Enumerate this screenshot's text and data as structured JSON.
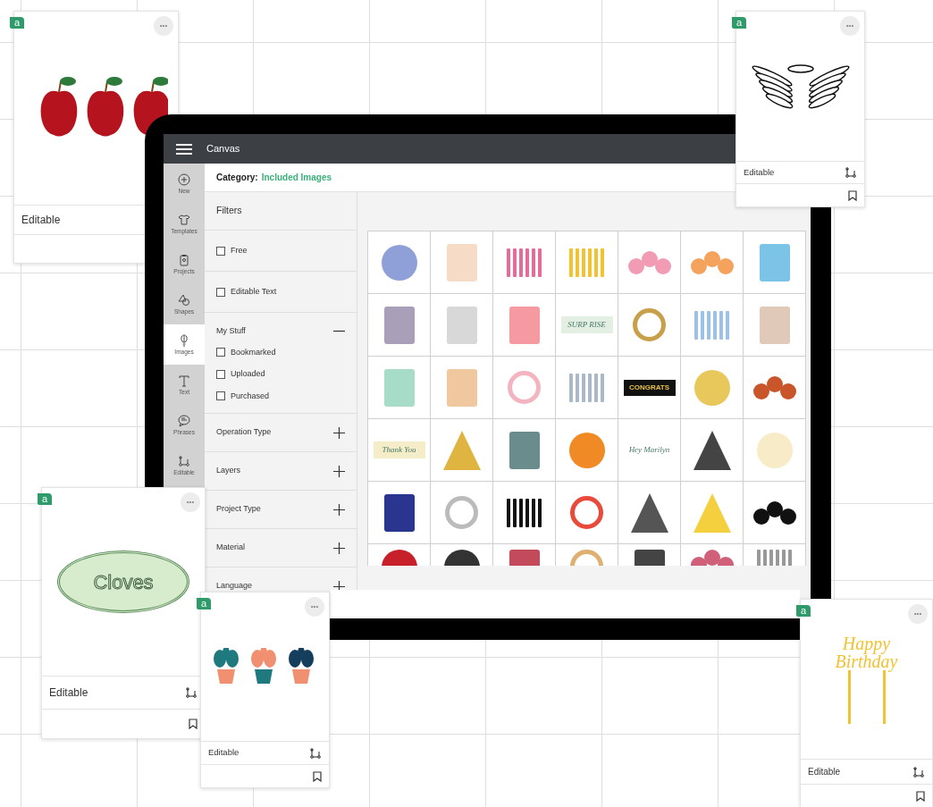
{
  "app": {
    "title": "Canvas",
    "category_label": "Category:",
    "category_value": "Included Images"
  },
  "sidebar": {
    "items": [
      {
        "label": "New",
        "selected": false
      },
      {
        "label": "Templates",
        "selected": false
      },
      {
        "label": "Projects",
        "selected": false
      },
      {
        "label": "Shapes",
        "selected": false
      },
      {
        "label": "Images",
        "selected": true
      },
      {
        "label": "Text",
        "selected": false
      },
      {
        "label": "Phrases",
        "selected": false
      },
      {
        "label": "Editable",
        "selected": false
      }
    ]
  },
  "filters": {
    "title": "Filters",
    "sections": [
      {
        "kind": "checkbox",
        "label": "Free",
        "checked": false
      },
      {
        "kind": "checkbox",
        "label": "Editable Text",
        "checked": false
      },
      {
        "kind": "group",
        "label": "My Stuff",
        "expanded": true,
        "items": [
          {
            "label": "Bookmarked",
            "checked": false
          },
          {
            "label": "Uploaded",
            "checked": false
          },
          {
            "label": "Purchased",
            "checked": false
          }
        ]
      },
      {
        "kind": "group",
        "label": "Operation Type",
        "expanded": false
      },
      {
        "kind": "group",
        "label": "Layers",
        "expanded": false
      },
      {
        "kind": "group",
        "label": "Project Type",
        "expanded": false
      },
      {
        "kind": "group",
        "label": "Material",
        "expanded": false
      },
      {
        "kind": "group",
        "label": "Language",
        "expanded": false
      }
    ]
  },
  "tiles": [
    {
      "kind": "circle",
      "color": "#8fa0d8"
    },
    {
      "kind": "rect",
      "color": "#f6dcc6"
    },
    {
      "kind": "bars",
      "color": "#e86a9a"
    },
    {
      "kind": "bars",
      "color": "#f2c230"
    },
    {
      "kind": "circles3",
      "color": "#f29bb5"
    },
    {
      "kind": "circles3",
      "color": "#f5a25d"
    },
    {
      "kind": "rect",
      "color": "#7cc3e8"
    },
    {
      "kind": "rect",
      "color": "#a99fb8"
    },
    {
      "kind": "rect",
      "color": "#d8d8d8"
    },
    {
      "kind": "rect",
      "color": "#f49aa0"
    },
    {
      "kind": "text",
      "text": "SURP RISE",
      "color": "#e3efe2"
    },
    {
      "kind": "ring",
      "color": "#c9a04a"
    },
    {
      "kind": "bars",
      "color": "#9cc1e8"
    },
    {
      "kind": "rect",
      "color": "#e0c9b8"
    },
    {
      "kind": "rect",
      "color": "#a7dcc8"
    },
    {
      "kind": "rect",
      "color": "#f0c8a0"
    },
    {
      "kind": "ring",
      "color": "#f4b3c0"
    },
    {
      "kind": "bars",
      "color": "#a9b9c9"
    },
    {
      "kind": "text",
      "text": "CONGRATS",
      "color": "#111111"
    },
    {
      "kind": "circle",
      "color": "#e8c85a"
    },
    {
      "kind": "circles3",
      "color": "#c8562a"
    },
    {
      "kind": "text",
      "text": "Thank You",
      "color": "#f5ecc8"
    },
    {
      "kind": "tri",
      "color": "#e0b440"
    },
    {
      "kind": "rect",
      "color": "#6a8c8c"
    },
    {
      "kind": "circle",
      "color": "#f08a24"
    },
    {
      "kind": "text",
      "text": "Hey Marilyn",
      "color": "#ffffff"
    },
    {
      "kind": "tri",
      "color": "#444444"
    },
    {
      "kind": "circle",
      "color": "#f8ecc8"
    },
    {
      "kind": "rect",
      "color": "#2a3590"
    },
    {
      "kind": "ring",
      "color": "#bbbbbb"
    },
    {
      "kind": "bars",
      "color": "#111111"
    },
    {
      "kind": "ring",
      "color": "#e94a3a"
    },
    {
      "kind": "tri",
      "color": "#555555"
    },
    {
      "kind": "tri",
      "color": "#f4d03f"
    },
    {
      "kind": "circles3",
      "color": "#111111"
    },
    {
      "kind": "circle",
      "color": "#c8202a"
    },
    {
      "kind": "circle",
      "color": "#333333"
    },
    {
      "kind": "rect",
      "color": "#c24a5a"
    },
    {
      "kind": "ring",
      "color": "#e0b070"
    },
    {
      "kind": "rect",
      "color": "#444444"
    },
    {
      "kind": "circles3",
      "color": "#d0607a"
    },
    {
      "kind": "bars",
      "color": "#999999"
    }
  ],
  "cards": [
    {
      "badge": "a",
      "menu": "•••",
      "label": "Editable",
      "edit_icon": false,
      "bookmark_icon": false
    },
    {
      "badge": "a",
      "menu": "•••",
      "label": "Editable",
      "edit_icon": true,
      "bookmark_icon": true
    },
    {
      "badge": "a",
      "menu": "•••",
      "art_text": "Cloves",
      "label": "Editable",
      "edit_icon": true,
      "bookmark_icon": true
    },
    {
      "badge": "a",
      "menu": "•••",
      "label": "Editable",
      "edit_icon": true,
      "bookmark_icon": true
    },
    {
      "badge": "a",
      "menu": "•••",
      "art_text": "Happy Birthday",
      "label": "Editable",
      "edit_icon": true,
      "bookmark_icon": true
    }
  ]
}
